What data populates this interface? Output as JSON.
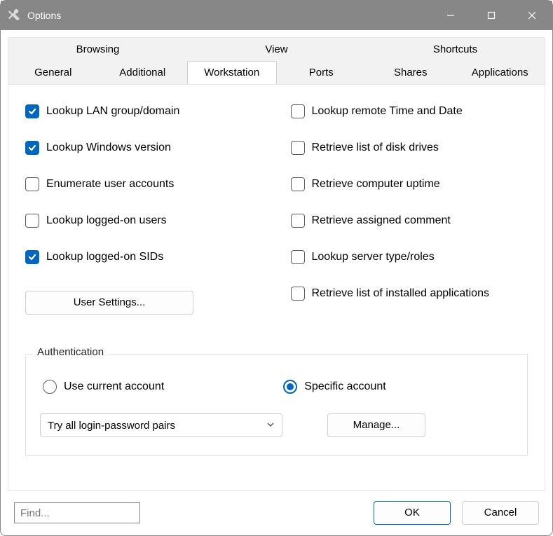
{
  "window": {
    "title": "Options"
  },
  "tabs": {
    "row1": [
      "Browsing",
      "View",
      "Shortcuts"
    ],
    "row2": [
      "General",
      "Additional",
      "Workstation",
      "Ports",
      "Shares",
      "Applications"
    ],
    "active": "Workstation"
  },
  "checkboxes": {
    "left": [
      {
        "label": "Lookup LAN group/domain",
        "checked": true
      },
      {
        "label": "Lookup Windows version",
        "checked": true
      },
      {
        "label": "Enumerate user accounts",
        "checked": false
      },
      {
        "label": "Lookup logged-on users",
        "checked": false
      },
      {
        "label": "Lookup logged-on SIDs",
        "checked": true
      }
    ],
    "right": [
      {
        "label": "Lookup remote Time and Date",
        "checked": false
      },
      {
        "label": "Retrieve list of disk drives",
        "checked": false
      },
      {
        "label": "Retrieve computer uptime",
        "checked": false
      },
      {
        "label": "Retrieve assigned comment",
        "checked": false
      },
      {
        "label": "Lookup server type/roles",
        "checked": false
      },
      {
        "label": "Retrieve list of installed applications",
        "checked": false
      }
    ]
  },
  "buttons": {
    "user_settings": "User Settings...",
    "manage": "Manage...",
    "ok": "OK",
    "cancel": "Cancel"
  },
  "auth": {
    "group_label": "Authentication",
    "radio_current": "Use current account",
    "radio_specific": "Specific account",
    "selected": "specific",
    "combo_value": "Try all login-password pairs"
  },
  "find": {
    "placeholder": "Find..."
  }
}
